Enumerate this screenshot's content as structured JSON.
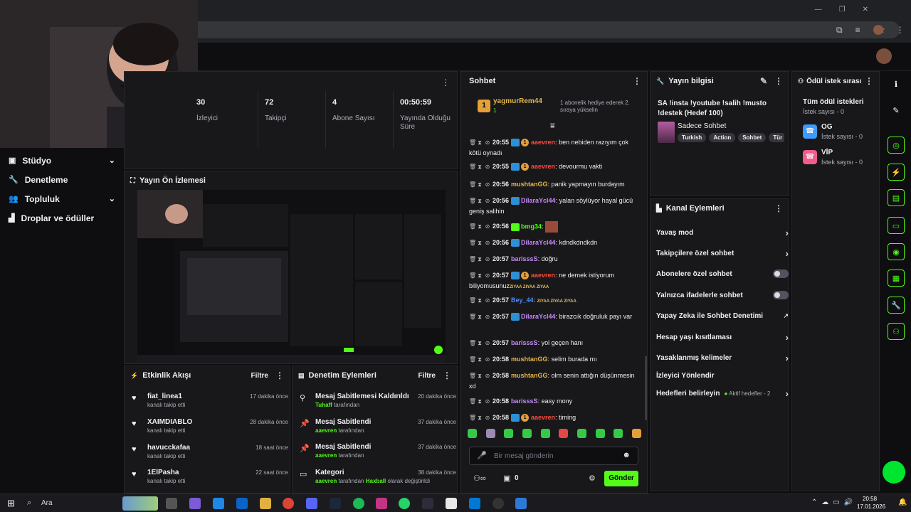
{
  "webcam": {
    "label": "webcam-overlay"
  },
  "left_nav": {
    "items": [
      {
        "label": "Stüdyo",
        "expandable": true
      },
      {
        "label": "Denetleme",
        "expandable": false
      },
      {
        "label": "Topluluk",
        "expandable": true
      },
      {
        "label": "Droplar ve ödüller",
        "expandable": false
      }
    ]
  },
  "stats": [
    {
      "value": "30",
      "label": "İzleyici"
    },
    {
      "value": "72",
      "label": "Takipçi"
    },
    {
      "value": "4",
      "label": "Abone Sayısı"
    },
    {
      "value": "00:50:59",
      "label": "Yayında Olduğu Süre"
    }
  ],
  "preview": {
    "title": "Yayın Ön İzlemesi"
  },
  "activity": {
    "title": "Etkinlik Akışı",
    "filter": "Filtre",
    "items": [
      {
        "name": "fiat_linea1",
        "sub": "kanalı takip etti",
        "time": "17 dakika önce"
      },
      {
        "name": "XAIMDIABLO",
        "sub": "kanalı takip etti",
        "time": "28 dakika önce"
      },
      {
        "name": "havucckafaa",
        "sub": "kanalı takip etti",
        "time": "18 saat önce"
      },
      {
        "name": "1ElPasha",
        "sub": "kanalı takip etti",
        "time": "22 saat önce"
      }
    ]
  },
  "moderation": {
    "title": "Denetim Eylemleri",
    "filter": "Filtre",
    "items": [
      {
        "title": "Mesaj Sabitlemesi Kaldırıldı",
        "user": "Tuhaff",
        "sub": "tarafından",
        "time": "20 dakika önce",
        "icon": "unpin-icon"
      },
      {
        "title": "Mesaj Sabitlendi",
        "user": "aaevren",
        "sub": "tarafından",
        "time": "37 dakika önce",
        "icon": "pin-icon"
      },
      {
        "title": "Mesaj Sabitlendi",
        "user": "aaevren",
        "sub": "tarafından",
        "time": "37 dakika önce",
        "icon": "pin-icon"
      },
      {
        "title": "Kategori",
        "user": "aaevren",
        "sub": "tarafından",
        "extra_user": "Haxball",
        "extra": "olarak değiştirildi",
        "time": "38 dakika önce",
        "icon": "category-icon"
      }
    ]
  },
  "chat": {
    "title": "Sohbet",
    "gift": {
      "user": "yagmurRem44",
      "count": "1",
      "text": "1 abonelik hediye ederek 2. sıraya yükselin"
    },
    "messages": [
      {
        "time": "20:55",
        "user": "aaevren",
        "color": "#ff4b3e",
        "badges": "sub",
        "text": "ben nebiden razıyım çok kötü oynadı"
      },
      {
        "time": "20:55",
        "user": "aaevren",
        "color": "#ff4b3e",
        "badges": "sub",
        "text": "devourmu vakti"
      },
      {
        "time": "20:56",
        "user": "mushtanGG",
        "color": "#e2b64a",
        "badges": "",
        "text": "panik yapmayın burdayım"
      },
      {
        "time": "20:56",
        "user": "DilaraYcl44",
        "color": "#c58af9",
        "badges": "b",
        "text": "yalan söylüyor hayal gücü geniş salihin"
      },
      {
        "time": "20:56",
        "user": "bmg34",
        "color": "#53fc18",
        "badges": "g",
        "text": ""
      },
      {
        "time": "20:56",
        "user": "DilaraYcl44",
        "color": "#c58af9",
        "badges": "b",
        "text": "kdndkdndkdn"
      },
      {
        "time": "20:57",
        "user": "barisssS",
        "color": "#c58af9",
        "badges": "",
        "text": "doğru"
      },
      {
        "time": "20:57",
        "user": "aaevren",
        "color": "#ff4b3e",
        "badges": "sub",
        "text": "ne demek istiyorum biliyomusunuz"
      },
      {
        "time": "20:57",
        "user": "Bey_44",
        "color": "#4a8cff",
        "badges": "",
        "text": ""
      },
      {
        "time": "20:57",
        "user": "DilaraYcl44",
        "color": "#c58af9",
        "badges": "b",
        "text": "birazcık doğruluk payı var"
      },
      {
        "time": "20:57",
        "user": "barisssS",
        "color": "#c58af9",
        "badges": "",
        "text": "yol geçen hanı"
      },
      {
        "time": "20:58",
        "user": "mushtanGG",
        "color": "#e2b64a",
        "badges": "",
        "text": "selim burada mı"
      },
      {
        "time": "20:58",
        "user": "mushtanGG",
        "color": "#e2b64a",
        "badges": "",
        "text": "olm senin attığın düşünmesin xd"
      },
      {
        "time": "20:58",
        "user": "barisssS",
        "color": "#c58af9",
        "badges": "",
        "text": "easy mony"
      },
      {
        "time": "20:58",
        "user": "aaevren",
        "color": "#ff4b3e",
        "badges": "sub1",
        "text": "timing"
      }
    ],
    "emote_text": "ZIYAA ZIYAA ZIYAA",
    "input_placeholder": "Bir mesaj gönderin",
    "points": "0",
    "send_label": "Gönder"
  },
  "stream_info": {
    "title": "Yayın bilgisi",
    "stream_title": "SA !insta !youtube !salih !musto !destek (Hedef 100)",
    "category": "Sadece Sohbet",
    "tags": [
      "Turkish",
      "Action",
      "Sohbet",
      "Tür"
    ]
  },
  "rewards": {
    "title": "Ödül istek sırası",
    "all_title": "Tüm ödül istekleri",
    "all_count": "İstek sayısı - 0",
    "items": [
      {
        "name": "OG",
        "count": "İstek sayısı - 0",
        "color": "#3b9cff"
      },
      {
        "name": "VİP",
        "count": "İstek sayısı - 0",
        "color": "#f25c8b"
      }
    ]
  },
  "channel_actions": {
    "title": "Kanal Eylemleri",
    "items": [
      {
        "label": "Yavaş mod",
        "control": "chevron"
      },
      {
        "label": "Takipçilere özel sohbet",
        "control": "chevron"
      },
      {
        "label": "Abonelere özel sohbet",
        "control": "toggle"
      },
      {
        "label": "Yalnızca ifadelerle sohbet",
        "control": "toggle"
      },
      {
        "label": "Yapay Zeka ile Sohbet Denetimi",
        "control": "external"
      },
      {
        "label": "Hesap yaşı kısıtlaması",
        "control": "chevron"
      },
      {
        "label": "Yasaklanmış kelimeler",
        "control": "chevron"
      },
      {
        "label": "İzleyici Yönlendir",
        "control": "none"
      },
      {
        "label": "Hedefleri belirleyin",
        "control": "chevron",
        "note": "Aktif hedefler - 2"
      }
    ]
  },
  "taskbar": {
    "search": "Ara",
    "time": "20:58",
    "date": "17.01.2026"
  },
  "colors": {
    "accent": "#53fc18",
    "panel": "#18181b",
    "bg": "#0e0e10"
  }
}
